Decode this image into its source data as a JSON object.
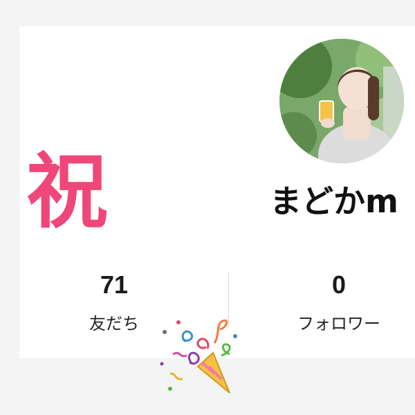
{
  "profile": {
    "celebration_text": "祝",
    "username": "まどかm",
    "avatar_icon": "profile-photo"
  },
  "stats": {
    "friends_count": "71",
    "friends_label": "友だち",
    "followers_count": "0",
    "followers_label": "フォロワー"
  },
  "decoration": {
    "party_icon": "party-popper-icon",
    "accent_color": "#f0477a"
  }
}
